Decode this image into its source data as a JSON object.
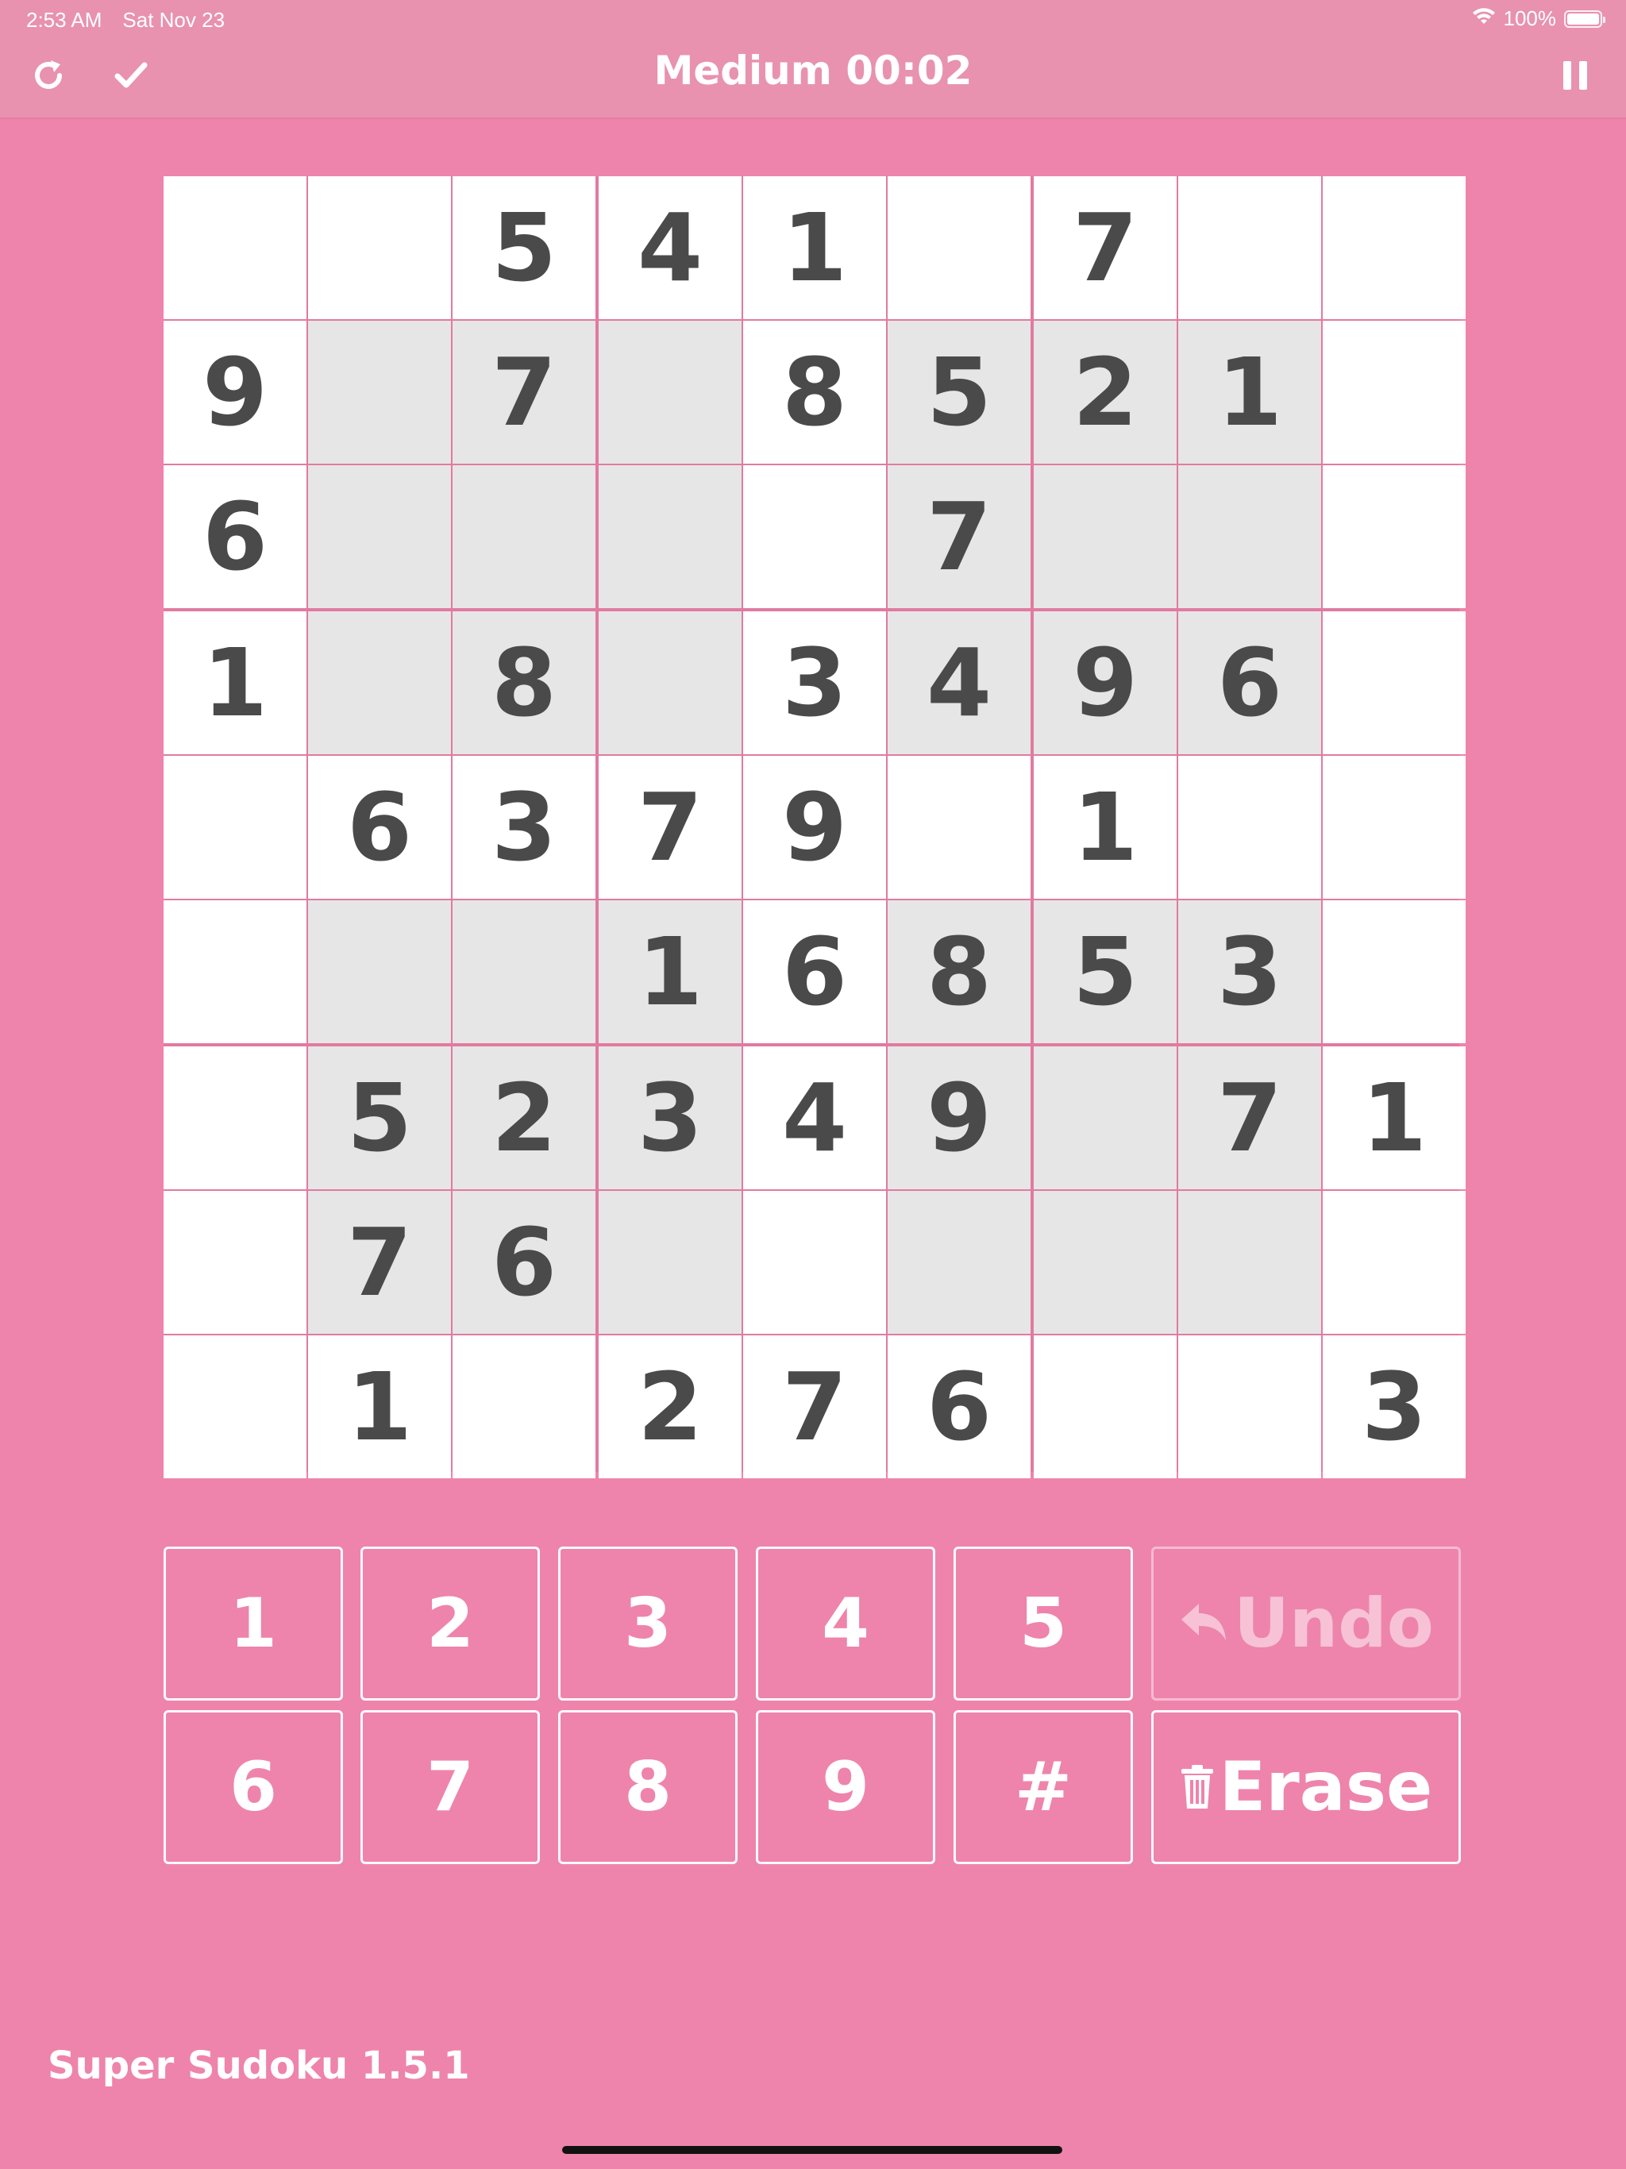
{
  "status": {
    "time": "2:53 AM",
    "date": "Sat Nov 23",
    "battery": "100%"
  },
  "nav": {
    "title": "Medium 00:02",
    "difficulty": "Medium",
    "timer": "00:02"
  },
  "board": {
    "grid": [
      [
        "",
        "",
        "5",
        "4",
        "1",
        "",
        "7",
        "",
        ""
      ],
      [
        "9",
        "",
        "7",
        "",
        "8",
        "5",
        "2",
        "1",
        ""
      ],
      [
        "6",
        "",
        "",
        "",
        "",
        "7",
        "",
        "",
        ""
      ],
      [
        "1",
        "",
        "8",
        "",
        "3",
        "4",
        "9",
        "6",
        ""
      ],
      [
        "",
        "6",
        "3",
        "7",
        "9",
        "",
        "1",
        "",
        ""
      ],
      [
        "",
        "",
        "",
        "1",
        "6",
        "8",
        "5",
        "3",
        ""
      ],
      [
        "",
        "5",
        "2",
        "3",
        "4",
        "9",
        "",
        "7",
        "1"
      ],
      [
        "",
        "7",
        "6",
        "",
        "",
        "",
        "",
        "",
        ""
      ],
      [
        "",
        "1",
        "",
        "2",
        "7",
        "6",
        "",
        "",
        "3"
      ]
    ],
    "highlighted": [
      [
        0,
        0,
        0,
        0,
        0,
        0,
        0,
        0,
        0
      ],
      [
        0,
        1,
        1,
        1,
        0,
        1,
        1,
        1,
        0
      ],
      [
        0,
        1,
        1,
        1,
        0,
        1,
        1,
        1,
        0
      ],
      [
        0,
        1,
        1,
        1,
        0,
        1,
        1,
        1,
        0
      ],
      [
        0,
        0,
        0,
        0,
        0,
        0,
        0,
        0,
        0
      ],
      [
        0,
        1,
        1,
        1,
        0,
        1,
        1,
        1,
        0
      ],
      [
        0,
        1,
        1,
        1,
        0,
        1,
        1,
        1,
        0
      ],
      [
        0,
        1,
        1,
        1,
        0,
        1,
        1,
        1,
        0
      ],
      [
        0,
        0,
        0,
        0,
        0,
        0,
        0,
        0,
        0
      ]
    ]
  },
  "keypad": {
    "k1": "1",
    "k2": "2",
    "k3": "3",
    "k4": "4",
    "k5": "5",
    "k6": "6",
    "k7": "7",
    "k8": "8",
    "k9": "9",
    "khash": "#",
    "undo": "Undo",
    "erase": "Erase"
  },
  "footer": {
    "version": "Super Sudoku 1.5.1"
  },
  "colors": {
    "background": "#ee84ab",
    "topbar": "#e892b0",
    "gridline": "#e27aa0",
    "cell": "#ffffff",
    "cell_highlight": "#e6e6e6",
    "digit": "#4a4a4a"
  },
  "icons": {
    "restart": "refresh-icon",
    "check": "checkmark-icon",
    "pause": "pause-icon",
    "undo": "undo-arrow-icon",
    "erase": "trash-icon",
    "wifi": "wifi-icon",
    "battery": "battery-icon"
  }
}
